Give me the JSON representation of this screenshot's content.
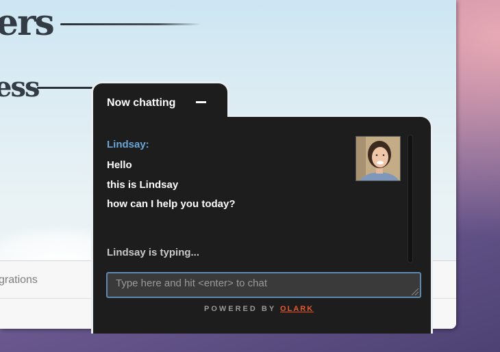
{
  "page": {
    "heading_1": "ers",
    "heading_2": "ess",
    "footer_link": "grations"
  },
  "chat": {
    "title": "Now chatting",
    "agent_name": "Lindsay:",
    "messages": [
      "Hello",
      "this is Lindsay",
      "how can I help you today?"
    ],
    "typing_status": "Lindsay is typing...",
    "input_placeholder": "Type here and hit <enter> to chat",
    "input_value": "",
    "powered_by": "POWERED BY",
    "brand": "OLARK"
  },
  "colors": {
    "widget_bg": "#1d1d1d",
    "agent_name": "#6aa6d8",
    "brand": "#e8582b",
    "input_border": "#5d89b3"
  },
  "icons": [
    "minimize-icon",
    "avatar",
    "resize-grip-icon"
  ]
}
